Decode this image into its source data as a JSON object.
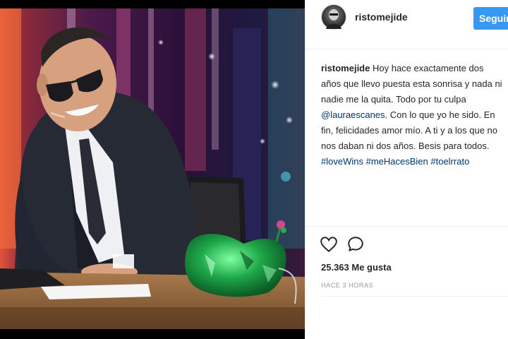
{
  "post": {
    "username": "ristomejide",
    "follow_label": "Seguir",
    "caption_user": "ristomejide",
    "caption_part1": "Hoy hace exactamente dos años que llevo puesta esta sonrisa y nada ni nadie me la quita. Todo por tu culpa",
    "mention": "@lauraescanes",
    "caption_part2": ". Con lo que yo he sido. En fin, felicidades amor mío. A ti y a los que no nos daban ni dos años. Besis para todos.",
    "hashtags": [
      "#loveWins",
      "#meHacesBien",
      "#toelrrato"
    ],
    "likes": "25.363 Me gusta",
    "time": "HACE 3 HORAS"
  },
  "icons": {
    "like": "heart-icon",
    "comment": "comment-icon"
  },
  "colors": {
    "follow_button": "#3897f0",
    "link": "#003569",
    "text": "#262626",
    "muted": "#999999"
  }
}
